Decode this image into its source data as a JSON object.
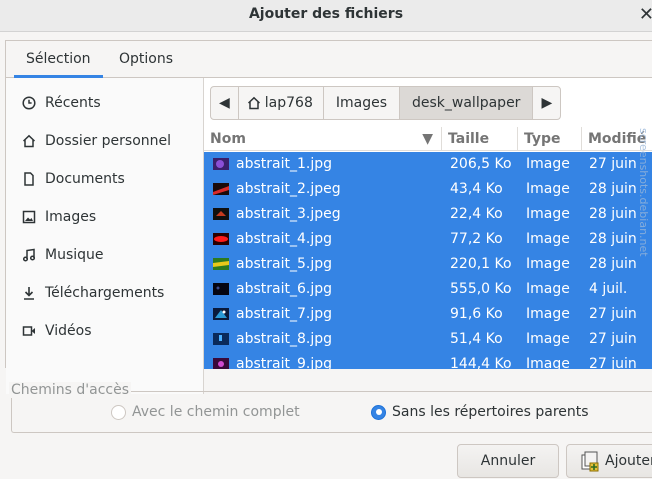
{
  "window": {
    "title": "Ajouter des fichiers"
  },
  "tabs": [
    {
      "label": "Sélection"
    },
    {
      "label": "Options"
    }
  ],
  "sidebar": {
    "items": [
      {
        "label": "Récents",
        "icon": "clock-icon"
      },
      {
        "label": "Dossier personnel",
        "icon": "home-icon"
      },
      {
        "label": "Documents",
        "icon": "document-icon"
      },
      {
        "label": "Images",
        "icon": "image-icon"
      },
      {
        "label": "Musique",
        "icon": "music-icon"
      },
      {
        "label": "Téléchargements",
        "icon": "download-icon"
      },
      {
        "label": "Vidéos",
        "icon": "video-icon"
      }
    ]
  },
  "pathbar": {
    "segments": [
      {
        "label": "lap768"
      },
      {
        "label": "Images"
      },
      {
        "label": "desk_wallpaper"
      }
    ]
  },
  "filelist": {
    "columns": [
      {
        "label": "Nom"
      },
      {
        "label": "Taille"
      },
      {
        "label": "Type"
      },
      {
        "label": "Modifié"
      }
    ],
    "rows": [
      {
        "name": "abstrait_1.jpg",
        "size": "206,5 Ko",
        "type": "Image",
        "modified": "27 juin"
      },
      {
        "name": "abstrait_2.jpeg",
        "size": "43,4 Ko",
        "type": "Image",
        "modified": "28 juin"
      },
      {
        "name": "abstrait_3.jpeg",
        "size": "22,4 Ko",
        "type": "Image",
        "modified": "28 juin"
      },
      {
        "name": "abstrait_4.jpg",
        "size": "77,2 Ko",
        "type": "Image",
        "modified": "28 juin"
      },
      {
        "name": "abstrait_5.jpg",
        "size": "220,1 Ko",
        "type": "Image",
        "modified": "28 juin"
      },
      {
        "name": "abstrait_6.jpg",
        "size": "555,0 Ko",
        "type": "Image",
        "modified": "4 juil."
      },
      {
        "name": "abstrait_7.jpg",
        "size": "91,6 Ko",
        "type": "Image",
        "modified": "27 juin"
      },
      {
        "name": "abstrait_8.jpg",
        "size": "51,4 Ko",
        "type": "Image",
        "modified": "27 juin"
      },
      {
        "name": "abstrait_9.jpg",
        "size": "144,4 Ko",
        "type": "Image",
        "modified": "27 juin"
      }
    ],
    "watermark": "screenshots.debian.net"
  },
  "paths": {
    "label": "Chemins d'accès",
    "options": [
      {
        "label": "Avec le chemin complet",
        "selected": false,
        "enabled": false
      },
      {
        "label": "Sans les répertoires parents",
        "selected": true,
        "enabled": true
      }
    ]
  },
  "buttons": {
    "cancel": "Annuler",
    "add": "Ajouter"
  },
  "colors": {
    "selection": "#3584e4",
    "accent": "#3584e4"
  }
}
